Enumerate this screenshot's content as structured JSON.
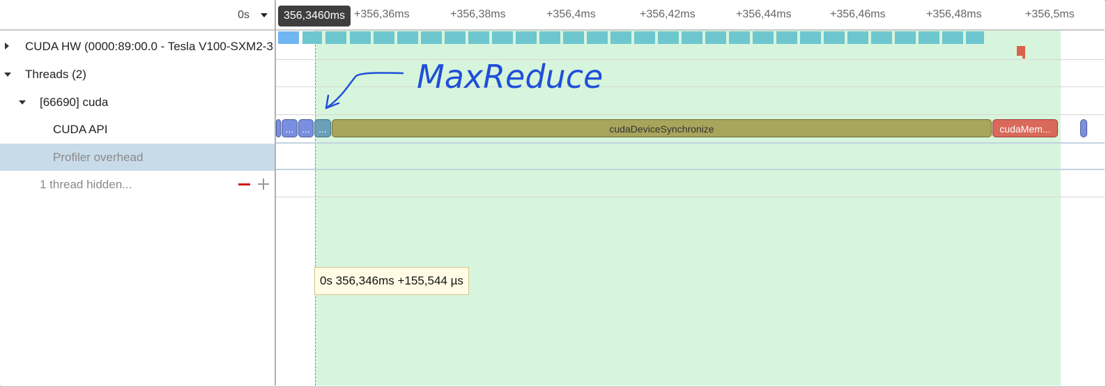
{
  "tree": {
    "time_origin": "0s",
    "rows": [
      {
        "label": "CUDA HW (0000:89:00.0 - Tesla V100-SXM2-3"
      },
      {
        "label": "Threads (2)"
      },
      {
        "label": "[66690] cuda"
      },
      {
        "label": "CUDA API"
      },
      {
        "label": "Profiler overhead"
      },
      {
        "label": "1 thread hidden..."
      }
    ]
  },
  "ruler": {
    "cursor_time": "356,3460ms",
    "ticks": [
      "+356,36ms",
      "+356,38ms",
      "+356,4ms",
      "+356,42ms",
      "+356,44ms",
      "+356,46ms",
      "+356,48ms",
      "+356,5ms"
    ]
  },
  "api_calls": {
    "short1": "...",
    "short2": "...",
    "short3": "...",
    "sync": "cudaDeviceSynchronize",
    "mem": "cudaMem..."
  },
  "tooltip": "0s 356,346ms +155,544 µs",
  "annotation": "MaxReduce",
  "colors": {
    "selection": "#d7f5dc",
    "row_selected": "#c8dbe9",
    "sync_call": "#a8a55c",
    "mem_call": "#d9695a",
    "short_call": "#7b8fe0",
    "annotation_ink": "#1f4fd8"
  },
  "icons": [
    "expand-arrow-icon",
    "collapse-arrow-icon",
    "dropdown-caret-icon",
    "minus-icon",
    "plus-icon"
  ]
}
